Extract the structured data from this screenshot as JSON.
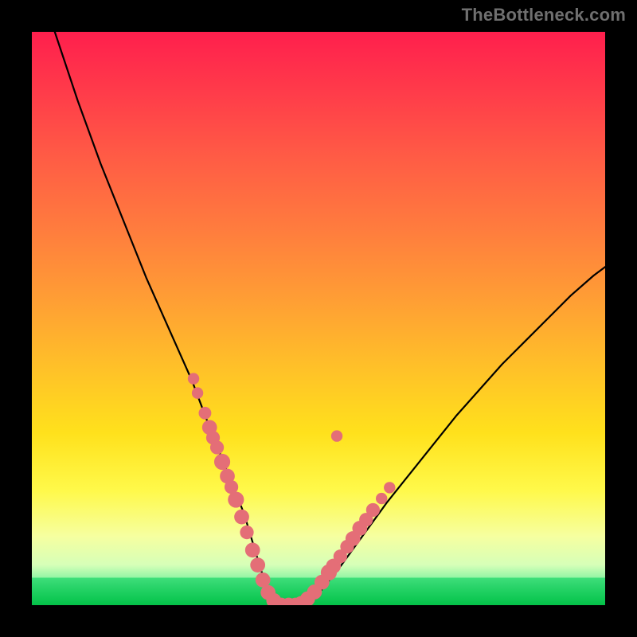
{
  "watermark": "TheBottleneck.com",
  "chart_data": {
    "type": "line",
    "title": "",
    "xlabel": "",
    "ylabel": "",
    "xlim": [
      0,
      100
    ],
    "ylim": [
      0,
      100
    ],
    "annotations": [],
    "series": [
      {
        "name": "curve",
        "x": [
          4,
          8,
          12,
          16,
          20,
          24,
          28,
          31,
          33,
          35,
          37,
          38.5,
          40,
          41.5,
          43,
          46,
          50,
          54,
          58,
          62,
          66,
          70,
          74,
          78,
          82,
          86,
          90,
          94,
          98,
          100
        ],
        "y": [
          100,
          88,
          77,
          67,
          57,
          48,
          39,
          31,
          26,
          21,
          16,
          11,
          6,
          2.5,
          0,
          0,
          2,
          7,
          12.5,
          18,
          23,
          28,
          33,
          37.5,
          42,
          46,
          50,
          54,
          57.5,
          59
        ]
      }
    ],
    "markers": {
      "name": "highlight-dots",
      "color": "#e46e77",
      "points": [
        {
          "x": 28.2,
          "y": 39.5,
          "r": 1.0
        },
        {
          "x": 28.9,
          "y": 37.0,
          "r": 1.0
        },
        {
          "x": 30.2,
          "y": 33.5,
          "r": 1.1
        },
        {
          "x": 31.0,
          "y": 31.0,
          "r": 1.3
        },
        {
          "x": 31.6,
          "y": 29.2,
          "r": 1.2
        },
        {
          "x": 32.3,
          "y": 27.5,
          "r": 1.2
        },
        {
          "x": 33.2,
          "y": 25.0,
          "r": 1.4
        },
        {
          "x": 34.1,
          "y": 22.5,
          "r": 1.3
        },
        {
          "x": 34.8,
          "y": 20.6,
          "r": 1.2
        },
        {
          "x": 35.6,
          "y": 18.4,
          "r": 1.4
        },
        {
          "x": 36.6,
          "y": 15.4,
          "r": 1.3
        },
        {
          "x": 37.5,
          "y": 12.7,
          "r": 1.2
        },
        {
          "x": 38.5,
          "y": 9.6,
          "r": 1.3
        },
        {
          "x": 39.4,
          "y": 7.0,
          "r": 1.3
        },
        {
          "x": 40.3,
          "y": 4.4,
          "r": 1.3
        },
        {
          "x": 41.2,
          "y": 2.2,
          "r": 1.3
        },
        {
          "x": 42.2,
          "y": 0.8,
          "r": 1.3
        },
        {
          "x": 43.5,
          "y": 0.0,
          "r": 1.3
        },
        {
          "x": 44.8,
          "y": 0.0,
          "r": 1.3
        },
        {
          "x": 46.0,
          "y": 0.0,
          "r": 1.3
        },
        {
          "x": 47.0,
          "y": 0.3,
          "r": 1.3
        },
        {
          "x": 48.1,
          "y": 1.1,
          "r": 1.3
        },
        {
          "x": 49.3,
          "y": 2.3,
          "r": 1.3
        },
        {
          "x": 50.6,
          "y": 4.0,
          "r": 1.3
        },
        {
          "x": 51.8,
          "y": 5.7,
          "r": 1.4
        },
        {
          "x": 52.6,
          "y": 6.8,
          "r": 1.3
        },
        {
          "x": 53.8,
          "y": 8.5,
          "r": 1.2
        },
        {
          "x": 55.0,
          "y": 10.2,
          "r": 1.2
        },
        {
          "x": 56.0,
          "y": 11.6,
          "r": 1.3
        },
        {
          "x": 57.2,
          "y": 13.4,
          "r": 1.3
        },
        {
          "x": 58.3,
          "y": 14.9,
          "r": 1.2
        },
        {
          "x": 59.5,
          "y": 16.6,
          "r": 1.2
        },
        {
          "x": 61.0,
          "y": 18.6,
          "r": 1.0
        },
        {
          "x": 62.4,
          "y": 20.5,
          "r": 1.0
        },
        {
          "x": 53.2,
          "y": 29.5,
          "r": 1.0
        }
      ]
    }
  }
}
